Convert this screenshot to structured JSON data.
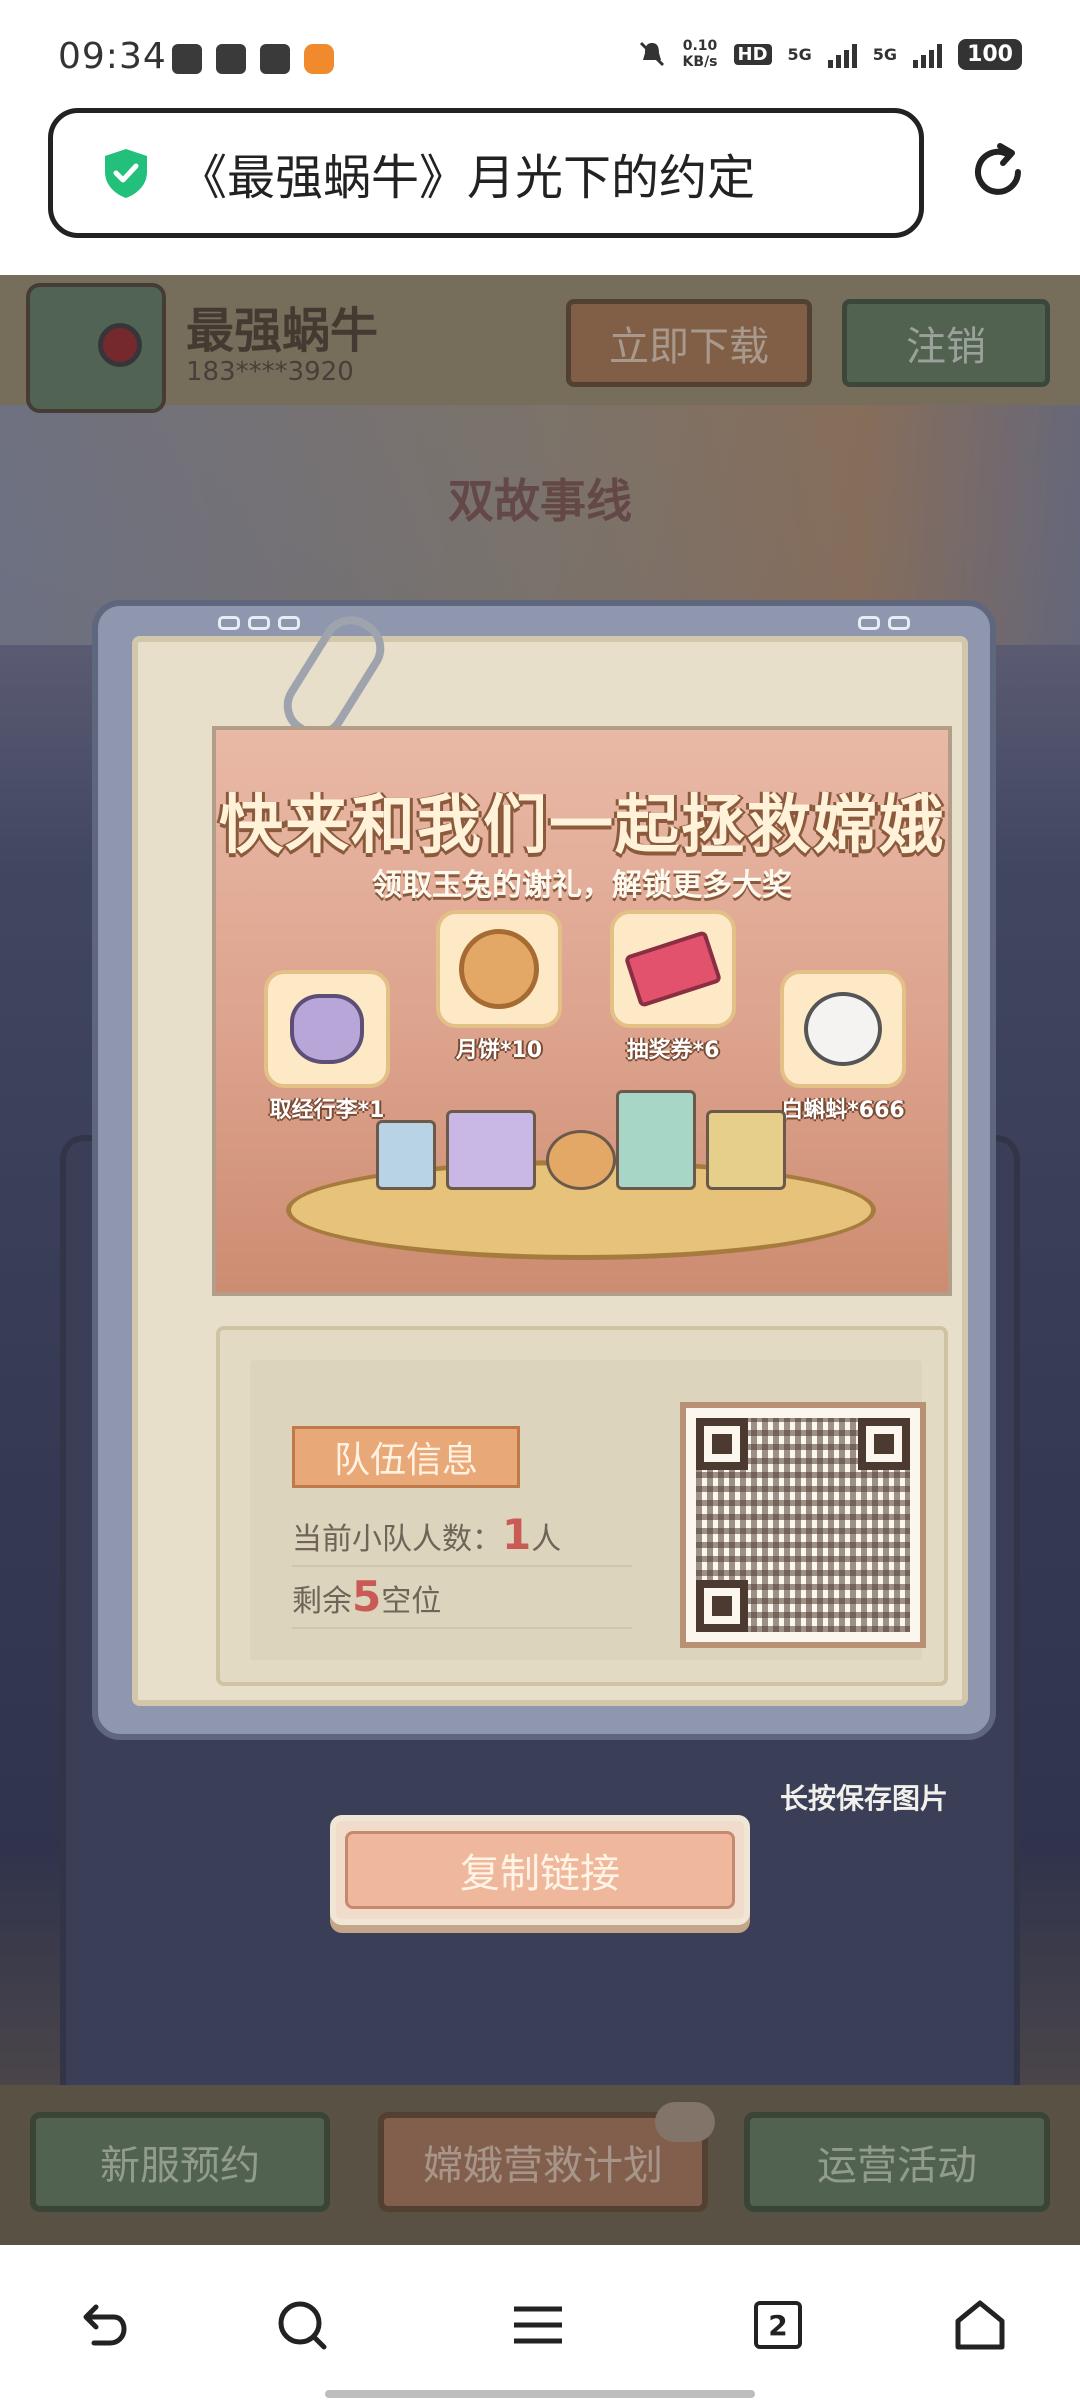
{
  "status_bar": {
    "time": "09:34",
    "net_speed_value": "0.10",
    "net_speed_unit": "KB/s",
    "hd_label": "HD",
    "sim1_label": "5G",
    "sim2_label": "5G",
    "battery": "100"
  },
  "browser": {
    "page_title": "《最强蜗牛》月光下的约定",
    "tab_count": "2"
  },
  "game_header": {
    "game_name": "最强蜗牛",
    "phone": "183****3920",
    "download_label": "立即下载",
    "logout_label": "注销"
  },
  "background": {
    "story_line": "双故事线"
  },
  "promo": {
    "title": "快来和我们一起拯救嫦娥",
    "subtitle": "领取玉兔的谢礼，解锁更多大奖",
    "rewards": [
      {
        "label": "取经行李*1",
        "icon": "luggage-bag-icon"
      },
      {
        "label": "月饼*10",
        "icon": "mooncake-icon"
      },
      {
        "label": "抽奖券*6",
        "icon": "lottery-ticket-icon"
      },
      {
        "label": "白蝌蚪*666",
        "icon": "white-tadpole-icon"
      }
    ]
  },
  "team": {
    "badge": "队伍信息",
    "members_prefix": "当前小队人数：",
    "members_count": "1",
    "members_suffix": "人",
    "slots_prefix": "剩余",
    "slots_count": "5",
    "slots_suffix": "空位"
  },
  "actions": {
    "long_press_hint": "长按保存图片",
    "copy_link_label": "复制链接"
  },
  "bottom_tabs": {
    "left": "新服预约",
    "center": "嫦娥营救计划",
    "right": "运营活动"
  },
  "colors": {
    "accent_orange": "#efb79b",
    "brand_green": "#6f8866",
    "highlight_red": "#c95a55"
  }
}
